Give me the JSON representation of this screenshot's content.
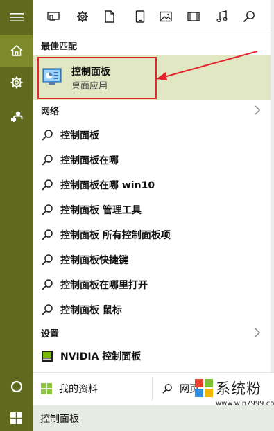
{
  "rail": {
    "items": [
      {
        "icon": "hamburger-menu-icon"
      },
      {
        "icon": "home-icon",
        "active": true
      },
      {
        "icon": "gear-icon"
      },
      {
        "icon": "feedback-icon"
      }
    ],
    "cortana_icon": "cortana-circle-icon"
  },
  "filters": [
    {
      "icon": "apps-filter-icon"
    },
    {
      "icon": "settings-filter-icon"
    },
    {
      "icon": "documents-filter-icon"
    },
    {
      "icon": "folders-filter-icon"
    },
    {
      "icon": "photos-filter-icon"
    },
    {
      "icon": "videos-filter-icon"
    },
    {
      "icon": "music-filter-icon"
    },
    {
      "icon": "web-filter-icon"
    }
  ],
  "best_match": {
    "header": "最佳匹配",
    "title": "控制面板",
    "subtitle": "桌面应用",
    "annotation_color": "#e0262c"
  },
  "web": {
    "header": "网络",
    "results": [
      "控制面板",
      "控制面板在哪",
      "控制面板在哪 win10",
      "控制面板 管理工具",
      "控制面板 所有控制面板项",
      "控制面板快捷键",
      "控制面板在哪里打开",
      "控制面板 鼠标"
    ]
  },
  "settings": {
    "header": "设置",
    "item": "NVIDIA 控制面板"
  },
  "scope": {
    "my_stuff": "我的资料",
    "web": "网页"
  },
  "taskbar": {
    "search_text": "控制面板"
  },
  "watermark": {
    "title": "系统粉",
    "url": "www.win7999.com"
  },
  "colors": {
    "accent": "#5f6a1e",
    "accent_active": "#7c8a2a",
    "best_match_bg": "#e2e7c3"
  }
}
